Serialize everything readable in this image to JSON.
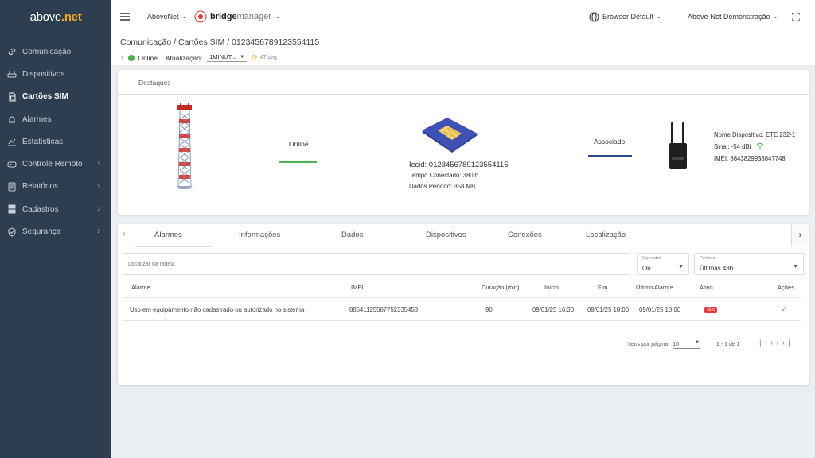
{
  "brand": {
    "logo_a": "above",
    "logo_b": "net"
  },
  "sidebar": {
    "items": [
      {
        "label": "Comunicação",
        "icon": "link-icon"
      },
      {
        "label": "Dispositivos",
        "icon": "router-icon"
      },
      {
        "label": "Cartões SIM",
        "icon": "sim-card-icon"
      },
      {
        "label": "Alarmes",
        "icon": "alarm-icon"
      },
      {
        "label": "Estatísticas",
        "icon": "chart-icon"
      },
      {
        "label": "Controle Remoto",
        "icon": "gamepad-icon"
      },
      {
        "label": "Relatórios",
        "icon": "report-icon"
      },
      {
        "label": "Cadastros",
        "icon": "database-icon"
      },
      {
        "label": "Segurança",
        "icon": "shield-icon"
      }
    ]
  },
  "topbar": {
    "org": "AboveNet",
    "product_a": "bridge",
    "product_b": "manager",
    "browser": "Browser Default",
    "user": "Above-Net Demonstração"
  },
  "breadcrumb": "Comunicação / Cartões SIM  / 0123456789123554115",
  "status": {
    "online_label": "Online",
    "update_label": "Atualização:",
    "update_value": "1MINUT...",
    "countdown": "47 seg"
  },
  "highlights": {
    "tab": "Destaques",
    "link1": "Online",
    "iccid": "Iccid: 0123456789123554115",
    "connected": "Tempo Conectado: 380 h",
    "data": "Dados Período: 358 MB",
    "link2": "Associado",
    "device_name": "Nome Dispositivo: ETE 232-1",
    "signal": "Sinal: -54 dBi",
    "imei": "IMEI: 8843829938847748"
  },
  "tabs": [
    "Alarmes",
    "Informações",
    "Dados",
    "Dispositivos",
    "Conexões",
    "Localização"
  ],
  "filters": {
    "search_placeholder": "Localizar na tabela",
    "operator_label": "Operador",
    "operator_value": "Ou",
    "period_label": "Período",
    "period_value": "Últimas 48h"
  },
  "table": {
    "headers": [
      "Alarme",
      "IMEI",
      "Duração (min)",
      "Início",
      "Fim",
      "Último Alarme",
      "Ativo",
      "Ações"
    ],
    "rows": [
      {
        "alarm": "Uso em equipamento não cadastrado ou autorizado no sistema",
        "imei": "88541125587752335458",
        "duration": "90",
        "start": "09/01/25 16:30",
        "end": "09/01/25 18:00",
        "last": "09/01/25 18:00",
        "active": "Sim"
      }
    ]
  },
  "pagination": {
    "per_page_label": "Itens por página",
    "per_page_value": "10",
    "range": "1 - 1 de 1"
  },
  "colors": {
    "sidebar": "#2c3e50",
    "online_green": "#4caf50",
    "associated_blue": "#2c4a8a",
    "badge_red": "#e53935"
  }
}
